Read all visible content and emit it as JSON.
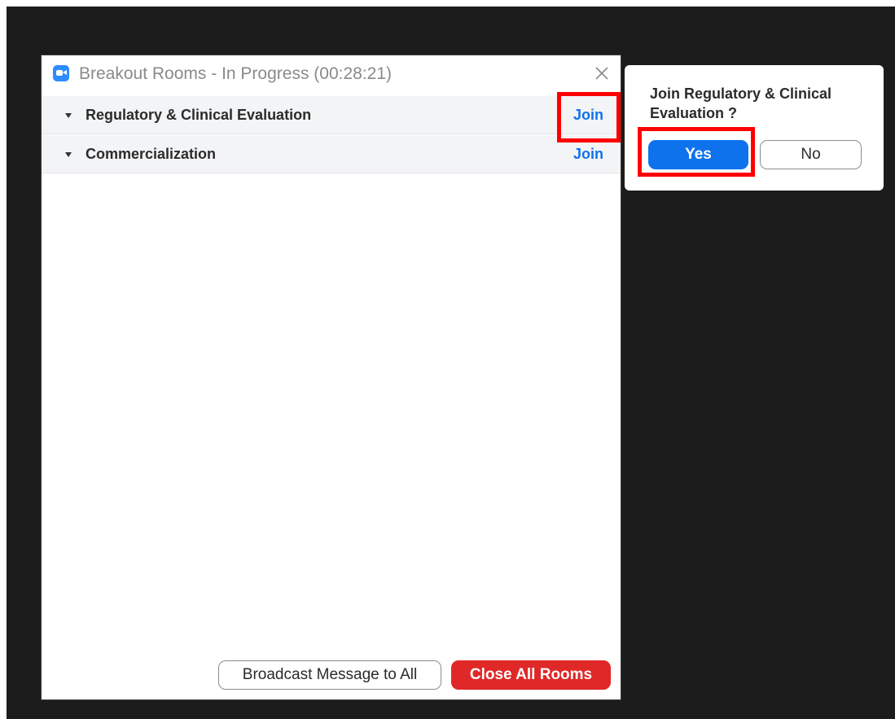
{
  "window": {
    "title": "Breakout Rooms - In Progress (00:28:21)",
    "app_icon": "zoom-camera-icon",
    "close_icon": "close-icon"
  },
  "rooms": [
    {
      "name": "Regulatory & Clinical Evaluation",
      "join_label": "Join"
    },
    {
      "name": "Commercialization",
      "join_label": "Join"
    }
  ],
  "footer": {
    "broadcast_label": "Broadcast Message to All",
    "close_all_label": "Close All Rooms"
  },
  "confirm": {
    "question": "Join Regulatory & Clinical Evaluation ?",
    "yes_label": "Yes",
    "no_label": "No"
  },
  "colors": {
    "accent_blue": "#0e72ed",
    "danger_red": "#e02828",
    "annotation_red": "#ff0000",
    "desktop_bg": "#1c1c1c"
  }
}
